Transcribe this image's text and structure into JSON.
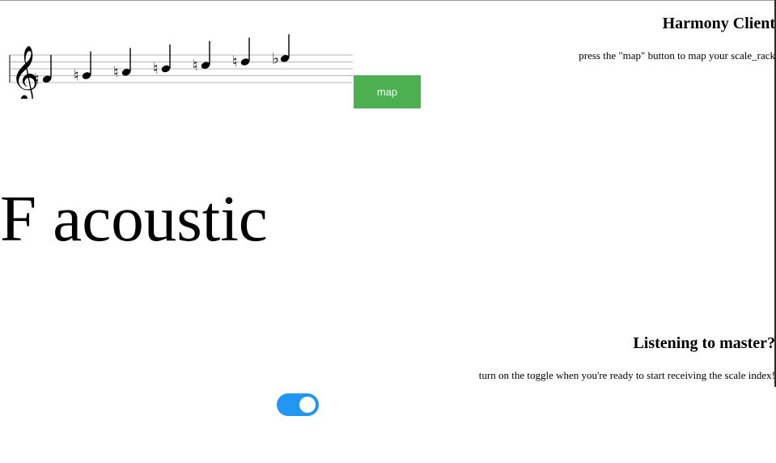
{
  "header": {
    "title": "Harmony Client",
    "instruction": "press the \"map\" button to map your scale_rack"
  },
  "notation": {
    "clef": "treble-clef",
    "notes": [
      {
        "name": "F4",
        "accidental": "natural"
      },
      {
        "name": "G4",
        "accidental": "natural"
      },
      {
        "name": "A4",
        "accidental": "natural"
      },
      {
        "name": "B4",
        "accidental": "natural"
      },
      {
        "name": "C5",
        "accidental": "natural"
      },
      {
        "name": "D5",
        "accidental": "natural"
      },
      {
        "name": "Eb5",
        "accidental": "flat"
      }
    ]
  },
  "map_button": {
    "label": "map"
  },
  "scale": {
    "name": "F acoustic"
  },
  "listening": {
    "title": "Listening to master?",
    "instruction": "turn on the toggle when you're ready to start receiving the scale index!"
  },
  "toggle": {
    "state": "on"
  },
  "colors": {
    "map_button_bg": "#4caf50",
    "toggle_on": "#2196f3",
    "staff_line": "#b5b5b5"
  }
}
